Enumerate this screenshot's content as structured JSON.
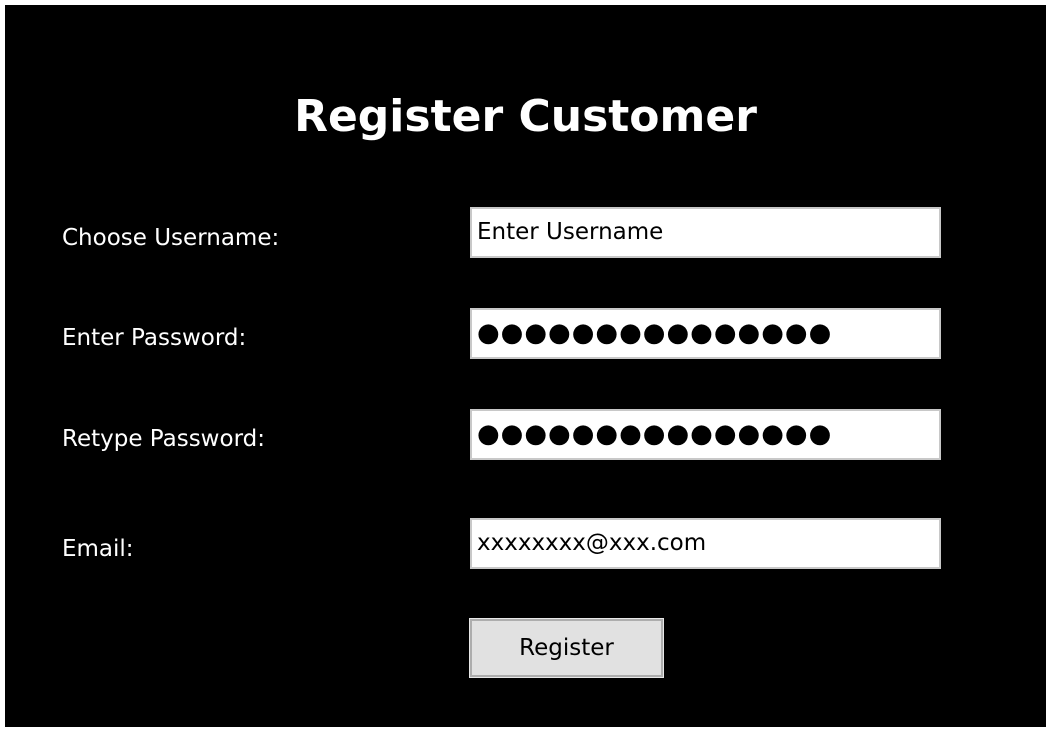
{
  "form": {
    "title": "Register Customer",
    "username_label": "Choose Username:",
    "username_value": "Enter Username",
    "password_label": "Enter Password:",
    "password_mask": "●●●●●●●●●●●●●●●",
    "retype_label": "Retype Password:",
    "retype_mask": "●●●●●●●●●●●●●●●",
    "email_label": "Email:",
    "email_value": "xxxxxxxx@xxx.com",
    "register_label": "Register"
  },
  "colors": {
    "background": "#000000",
    "text": "#ffffff",
    "field_background": "#ffffff",
    "button_background": "#e1e1e1"
  }
}
